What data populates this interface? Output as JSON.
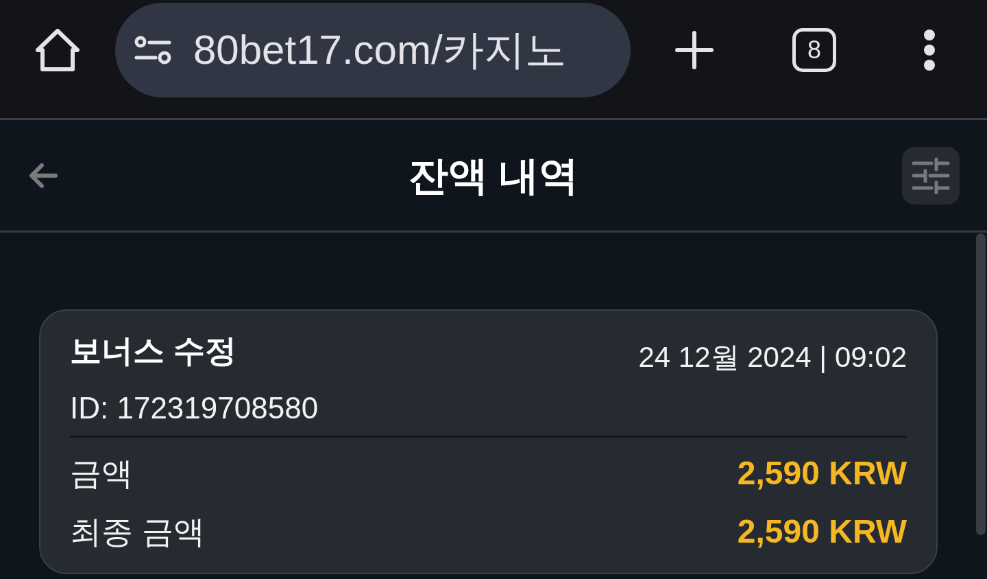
{
  "browser": {
    "url": "80bet17.com/카지노",
    "tab_count": "8"
  },
  "header": {
    "title": "잔액 내역"
  },
  "transactions": [
    {
      "title": "보너스 수정",
      "date": "24 12월 2024 | 09:02",
      "id": "ID: 172319708580",
      "rows": [
        {
          "label": "금액",
          "value": "2,590 KRW"
        },
        {
          "label": "최종 금액",
          "value": "2,590 KRW"
        }
      ]
    }
  ]
}
